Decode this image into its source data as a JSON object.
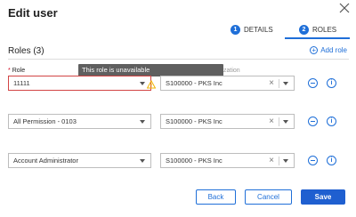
{
  "dialog": {
    "title": "Edit user"
  },
  "steps": [
    {
      "number": "1",
      "label": "DETAILS"
    },
    {
      "number": "2",
      "label": "ROLES"
    }
  ],
  "roles_section": {
    "heading": "Roles (3)",
    "add_role_label": "Add role",
    "field_label": "Role",
    "required_mark": "*"
  },
  "tooltip": {
    "text": "This role is unavailable",
    "tail_text": "Organization"
  },
  "rows": [
    {
      "role": "11111",
      "organization": "S100000 - PKS Inc",
      "error": true
    },
    {
      "role": "All Permission - 0103",
      "organization": "S100000 - PKS Inc",
      "error": false
    },
    {
      "role": "Account Administrator",
      "organization": "S100000 - PKS Inc",
      "error": false
    }
  ],
  "buttons": {
    "back": "Back",
    "cancel": "Cancel",
    "save": "Save"
  },
  "colors": {
    "accent": "#1f6fd8",
    "error": "#d24545",
    "warning": "#f0b400"
  }
}
